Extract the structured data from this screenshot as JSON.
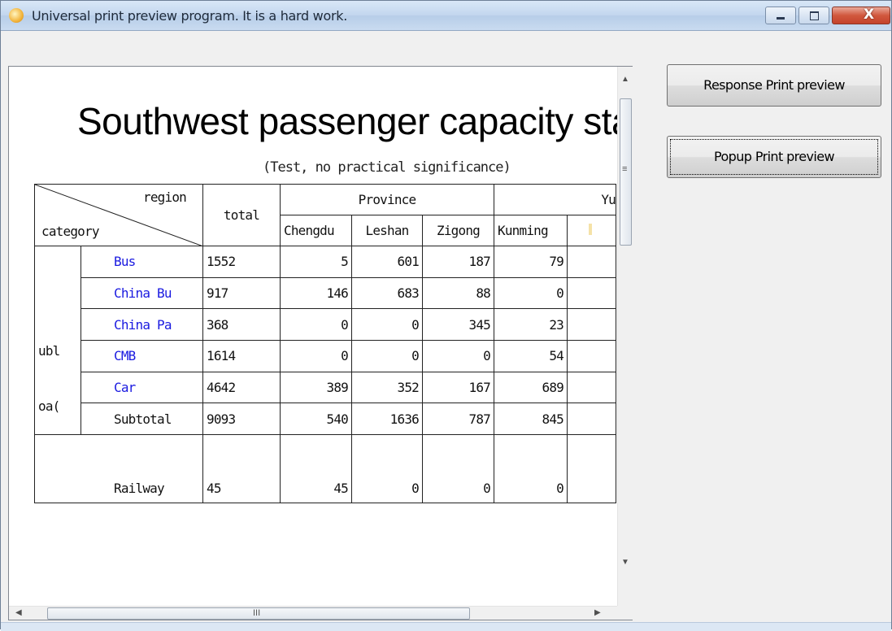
{
  "window": {
    "title": "Universal print preview program. It is a hard work.",
    "close_label": "X"
  },
  "document": {
    "title": "Southwest passenger capacity sta",
    "subtitle": "(Test, no practical significance)"
  },
  "table": {
    "header_region": "region",
    "header_category": "category",
    "header_total": "total",
    "group_province": "Province",
    "group_yu": "Yu",
    "columns": [
      "Chengdu",
      "Leshan",
      "Zigong",
      "Kunming"
    ],
    "row_group_1_a": "ubl",
    "row_group_1_b": "oa(",
    "rows": [
      {
        "label": "Bus",
        "total": "1552",
        "values": [
          "5",
          "601",
          "187",
          "79"
        ]
      },
      {
        "label": "China Bu",
        "total": "917",
        "values": [
          "146",
          "683",
          "88",
          "0"
        ]
      },
      {
        "label": "China Pa",
        "total": "368",
        "values": [
          "0",
          "0",
          "345",
          "23"
        ]
      },
      {
        "label": "CMB",
        "total": "1614",
        "values": [
          "0",
          "0",
          "0",
          "54"
        ]
      },
      {
        "label": "Car",
        "total": "4642",
        "values": [
          "389",
          "352",
          "167",
          "689"
        ]
      },
      {
        "label": "Subtotal",
        "total": "9093",
        "values": [
          "540",
          "1636",
          "787",
          "845"
        ]
      }
    ],
    "railway": {
      "label": "Railway",
      "total": "45",
      "values": [
        "45",
        "0",
        "0",
        "0"
      ]
    }
  },
  "buttons": {
    "response_preview": "Response Print preview",
    "popup_preview": "Popup Print preview"
  },
  "scroll": {
    "h_grip": "III",
    "v_grip": "≡"
  }
}
